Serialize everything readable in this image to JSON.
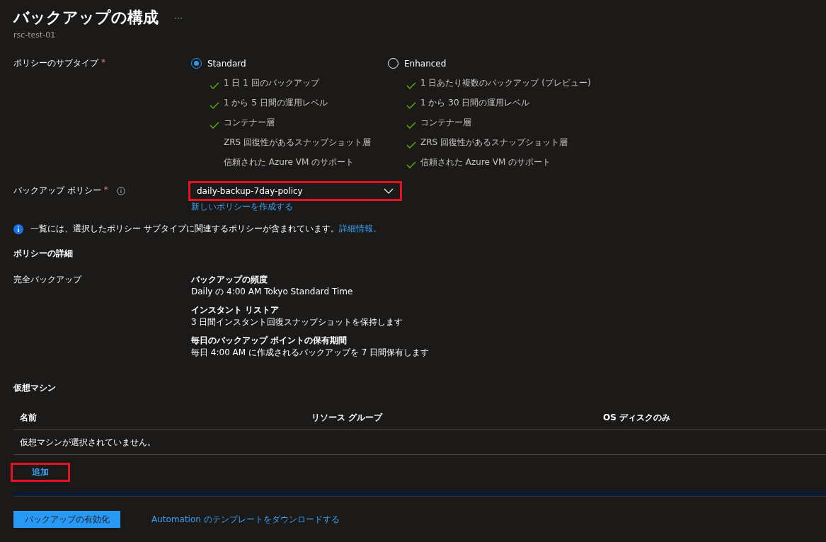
{
  "header": {
    "title": "バックアップの構成",
    "more": "···",
    "subtitle": "rsc-test-01"
  },
  "subtype": {
    "label": "ポリシーのサブタイプ",
    "required_mark": "*",
    "options": [
      {
        "label": "Standard",
        "selected": true,
        "features": [
          {
            "text": "1 日 1 回のバックアップ",
            "checked": true
          },
          {
            "text": "1 から 5 日間の運用レベル",
            "checked": true
          },
          {
            "text": "コンテナー層",
            "checked": true
          },
          {
            "text": "ZRS 回復性があるスナップショット層",
            "checked": false
          },
          {
            "text": "信頼された Azure VM のサポート",
            "checked": false
          }
        ]
      },
      {
        "label": "Enhanced",
        "selected": false,
        "features": [
          {
            "text": "1 日あたり複数のバックアップ (プレビュー)",
            "checked": true
          },
          {
            "text": "1 から 30 日間の運用レベル",
            "checked": true
          },
          {
            "text": "コンテナー層",
            "checked": true
          },
          {
            "text": "ZRS 回復性があるスナップショット層",
            "checked": true
          },
          {
            "text": "信頼された Azure VM のサポート",
            "checked": true
          }
        ]
      }
    ]
  },
  "policy": {
    "label": "バックアップ ポリシー",
    "required_mark": "*",
    "value": "daily-backup-7day-policy",
    "highlighted": true,
    "create_link": "新しいポリシーを作成する"
  },
  "info": {
    "text": "一覧には、選択したポリシー サブタイプに関連するポリシーが含まれています。",
    "link": "詳細情報。"
  },
  "details": {
    "heading": "ポリシーの詳細",
    "label": "完全バックアップ",
    "items": [
      {
        "title": "バックアップの頻度",
        "text": "Daily の 4:00 AM Tokyo Standard Time"
      },
      {
        "title": "インスタント リストア",
        "text": "3 日間インスタント回復スナップショットを保持します"
      },
      {
        "title": "毎日のバックアップ ポイントの保有期間",
        "text": "毎日 4:00 AM に作成されるバックアップを 7 日間保有します"
      }
    ]
  },
  "vms": {
    "heading": "仮想マシン",
    "columns": [
      "名前",
      "リソース グループ",
      "OS ディスクのみ"
    ],
    "empty": "仮想マシンが選択されていません。",
    "add": {
      "label": "追加",
      "highlighted": true
    }
  },
  "footer": {
    "primary": "バックアップの有効化",
    "link": "Automation のテンプレートをダウンロードする"
  }
}
